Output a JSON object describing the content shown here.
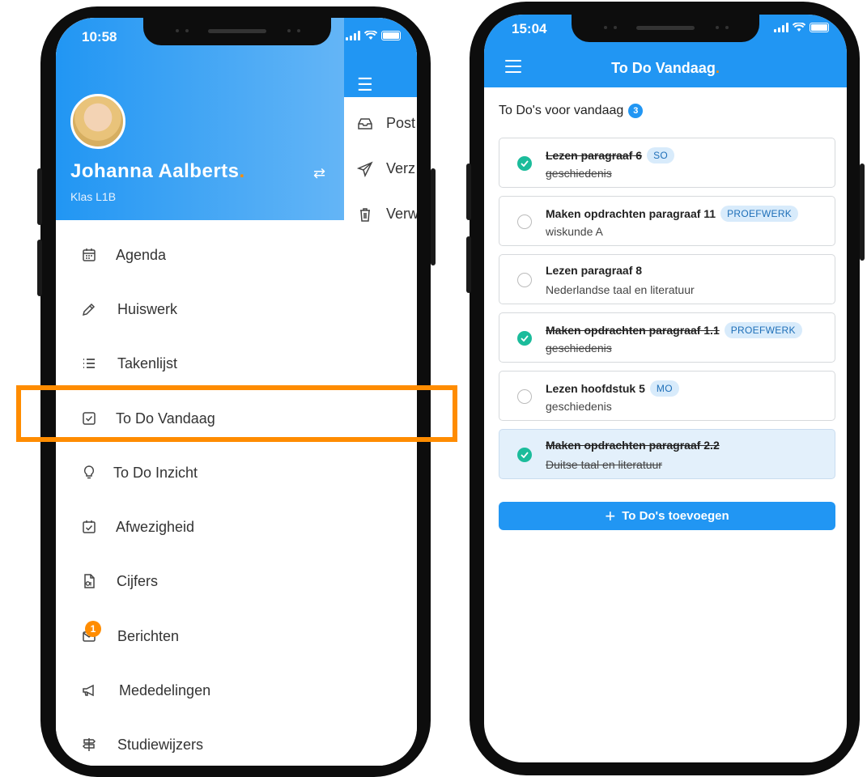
{
  "left_phone": {
    "status_time": "10:58",
    "user": {
      "name": "Johanna  Aalberts",
      "name_dot": ".",
      "class": "Klas L1B"
    },
    "background_items": [
      "Post",
      "Verz",
      "Verw"
    ],
    "menu": [
      {
        "label": "Agenda",
        "icon": "calendar-icon"
      },
      {
        "label": "Huiswerk",
        "icon": "pencil-icon"
      },
      {
        "label": "Takenlijst",
        "icon": "list-icon"
      },
      {
        "label": "To Do Vandaag",
        "icon": "checkbox-icon",
        "highlighted": true
      },
      {
        "label": "To Do Inzicht",
        "icon": "lightbulb-icon"
      },
      {
        "label": "Afwezigheid",
        "icon": "calendar-check-icon"
      },
      {
        "label": "Cijfers",
        "icon": "grades-icon"
      },
      {
        "label": "Berichten",
        "icon": "mail-icon",
        "badge": "1"
      },
      {
        "label": "Mededelingen",
        "icon": "megaphone-icon"
      },
      {
        "label": "Studiewijzers",
        "icon": "signpost-icon"
      }
    ]
  },
  "right_phone": {
    "status_time": "15:04",
    "title": "To Do Vandaag",
    "title_dot": ".",
    "section_title": "To Do's voor vandaag",
    "count": "3",
    "todos": [
      {
        "title": "Lezen paragraaf 6",
        "subject": "geschiedenis",
        "tag": "SO",
        "done": true
      },
      {
        "title": "Maken opdrachten paragraaf 11",
        "subject": "wiskunde A",
        "tag": "PROEFWERK",
        "done": false
      },
      {
        "title": "Lezen paragraaf 8",
        "subject": "Nederlandse taal en literatuur",
        "tag": "",
        "done": false
      },
      {
        "title": "Maken opdrachten paragraaf 1.1",
        "subject": "geschiedenis",
        "tag": "PROEFWERK",
        "done": true
      },
      {
        "title": "Lezen hoofdstuk 5",
        "subject": "geschiedenis",
        "tag": "MO",
        "done": false
      },
      {
        "title": "Maken opdrachten paragraaf 2.2",
        "subject": "Duitse taal en literatuur",
        "tag": "",
        "done": true,
        "selected": true
      }
    ],
    "add_button": "To Do's toevoegen"
  },
  "colors": {
    "primary": "#2196f3",
    "accent": "#ff8c00",
    "done": "#1bbc9b",
    "highlight": "#ff8c00"
  }
}
